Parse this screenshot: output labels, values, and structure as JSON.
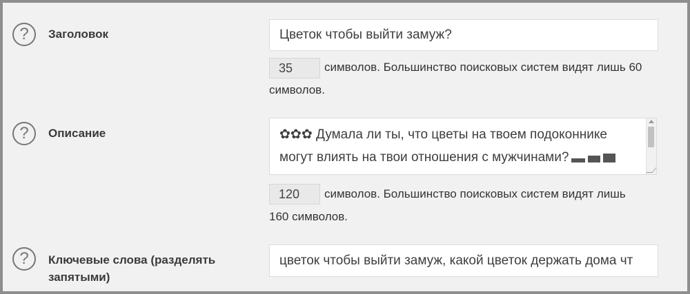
{
  "fields": [
    {
      "label": "Заголовок",
      "value": "Цветок чтобы выйти замуж?",
      "count": "35",
      "note_line1": "символов. Большинство поисковых систем видят лишь 60",
      "note_line2": "символов."
    },
    {
      "label": "Описание",
      "value_line1": "✿✿✿ Думала ли ты, что цветы на твоем подоконнике",
      "value_line2": "могут влиять на твои отношения с мужчинами?",
      "count": "120",
      "note_line1": "символов. Большинство поисковых систем видят лишь",
      "note_line2": "160 символов."
    },
    {
      "label": "Ключевые слова (разделять запятыми)",
      "value": "цветок чтобы выйти замуж, какой цветок держать дома чт"
    }
  ],
  "icons": {
    "help": "question-mark-circle-icon"
  }
}
